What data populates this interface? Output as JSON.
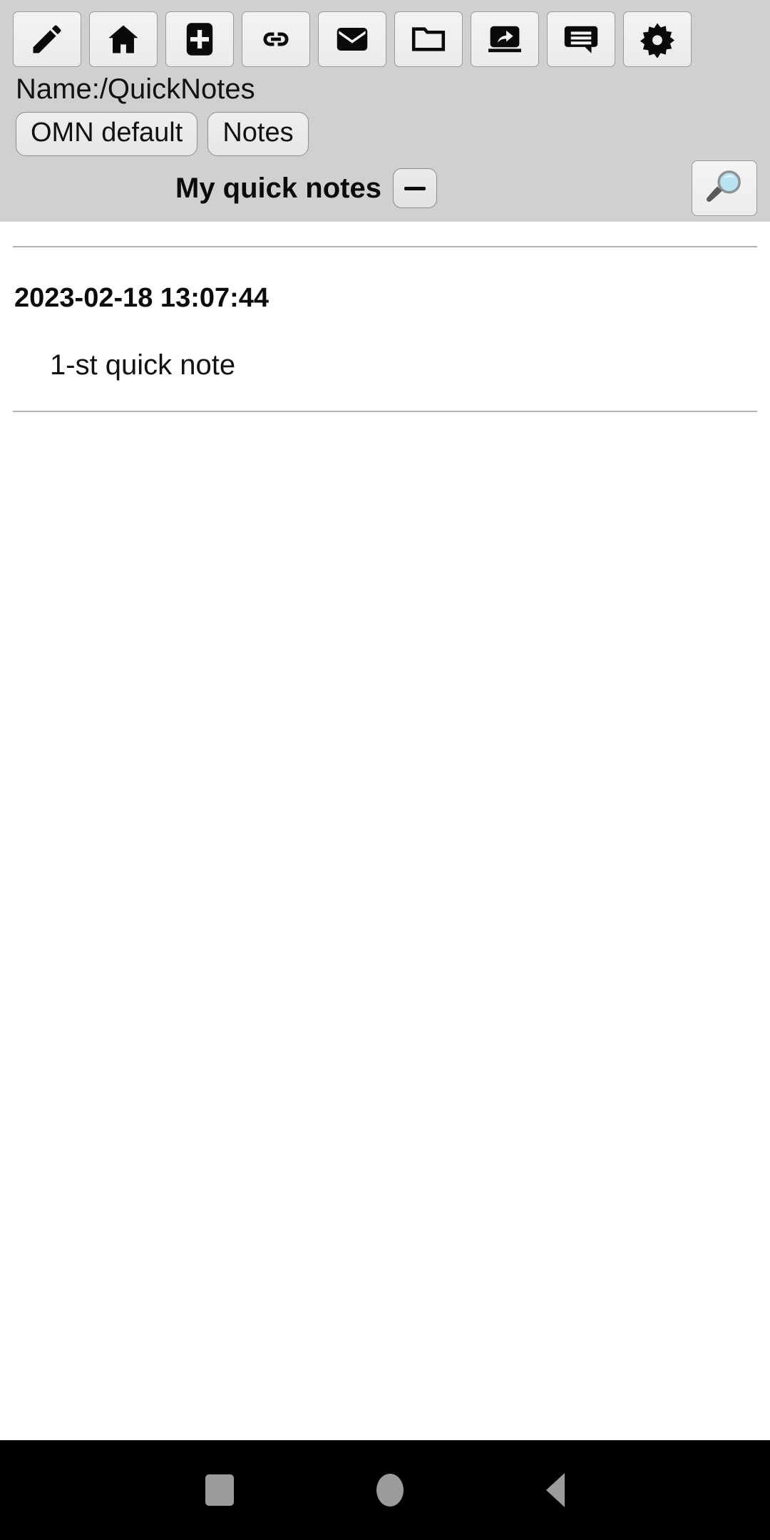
{
  "toolbar": {
    "buttons": [
      {
        "name": "edit-icon",
        "label": "Edit"
      },
      {
        "name": "home-icon",
        "label": "Home"
      },
      {
        "name": "add-icon",
        "label": "Add"
      },
      {
        "name": "link-icon",
        "label": "Link"
      },
      {
        "name": "mail-icon",
        "label": "Mail"
      },
      {
        "name": "folder-icon",
        "label": "Folder"
      },
      {
        "name": "share-screen-icon",
        "label": "Share"
      },
      {
        "name": "chat-icon",
        "label": "Chat"
      },
      {
        "name": "gear-icon",
        "label": "Settings"
      }
    ]
  },
  "path": {
    "label": "Name:/QuickNotes"
  },
  "chips": [
    {
      "label": "OMN default"
    },
    {
      "label": "Notes"
    }
  ],
  "header": {
    "title": "My quick notes",
    "collapse_label": "−",
    "search_icon": "magnifier-icon"
  },
  "notes": [
    {
      "timestamp": "2023-02-18 13:07:44",
      "text": "1-st quick note"
    }
  ],
  "navbar": {
    "recents_label": "Recents",
    "home_label": "Home",
    "back_label": "Back"
  },
  "colors": {
    "chrome_bg": "#d0d0d0",
    "content_bg": "#ffffff",
    "rule": "#b3b3b3",
    "navbar_bg": "#000000",
    "nav_glyph": "#9b9b9b",
    "lens": "#bde4f4"
  }
}
